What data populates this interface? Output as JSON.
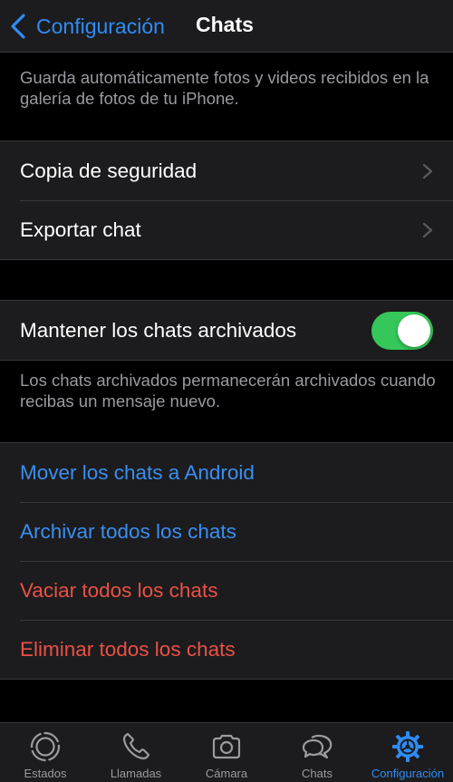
{
  "navbar": {
    "back_label": "Configuración",
    "title": "Chats"
  },
  "media_note": "Guarda automáticamente fotos y videos recibidos en la galería de fotos de tu iPhone.",
  "backup_group": {
    "items": [
      {
        "label": "Copia de seguridad"
      },
      {
        "label": "Exportar chat"
      }
    ]
  },
  "archive_group": {
    "keep_archived_label": "Mantener los chats archivados",
    "keep_archived_enabled": true
  },
  "archive_note": "Los chats archivados permanecerán archivados cuando recibas un mensaje nuevo.",
  "actions": {
    "move_android": "Mover los chats a Android",
    "archive_all": "Archivar todos los chats",
    "clear_all": "Vaciar todos los chats",
    "delete_all": "Eliminar todos los chats"
  },
  "colors": {
    "accent_blue": "#2f8cf4",
    "destructive_red": "#eb5044",
    "toggle_green": "#35c759"
  },
  "tabbar": {
    "items": [
      {
        "label": "Estados",
        "icon": "status-icon"
      },
      {
        "label": "Llamadas",
        "icon": "phone-icon"
      },
      {
        "label": "Cámara",
        "icon": "camera-icon"
      },
      {
        "label": "Chats",
        "icon": "chat-bubbles-icon"
      },
      {
        "label": "Configuración",
        "icon": "gear-icon",
        "active": true
      }
    ]
  }
}
